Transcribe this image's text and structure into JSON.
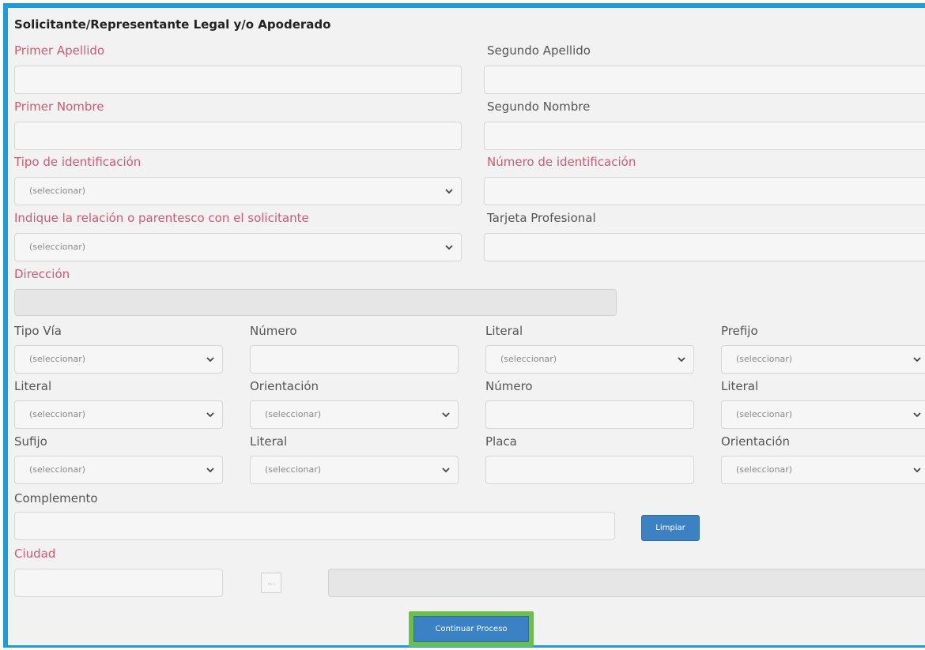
{
  "section": {
    "title": "Solicitante/Representante Legal y/o Apoderado"
  },
  "labels": {
    "primer_apellido": "Primer Apellido",
    "segundo_apellido": "Segundo Apellido",
    "primer_nombre": "Primer Nombre",
    "segundo_nombre": "Segundo Nombre",
    "tipo_identificacion": "Tipo de identificación",
    "numero_identificacion": "Número de identificación",
    "relacion": "Indique la relación o parentesco con el solicitante",
    "tarjeta_profesional": "Tarjeta Profesional",
    "direccion": "Dirección",
    "tipo_via": "Tipo Vía",
    "numero": "Número",
    "literal": "Literal",
    "prefijo": "Prefijo",
    "orientacion": "Orientación",
    "sufijo": "Sufijo",
    "placa": "Placa",
    "complemento": "Complemento",
    "ciudad": "Ciudad"
  },
  "select_placeholder": "(seleccionar)",
  "buttons": {
    "limpiar": "Limpiar",
    "dots": "...",
    "continuar": "Continuar Proceso"
  },
  "colors": {
    "required_label": "#d05a72",
    "accent_border": "#1e9be0",
    "button_blue": "#3a82c4",
    "highlight_green": "#6cc04a"
  },
  "icons": {
    "select_arrow": "chevron-down-icon"
  }
}
